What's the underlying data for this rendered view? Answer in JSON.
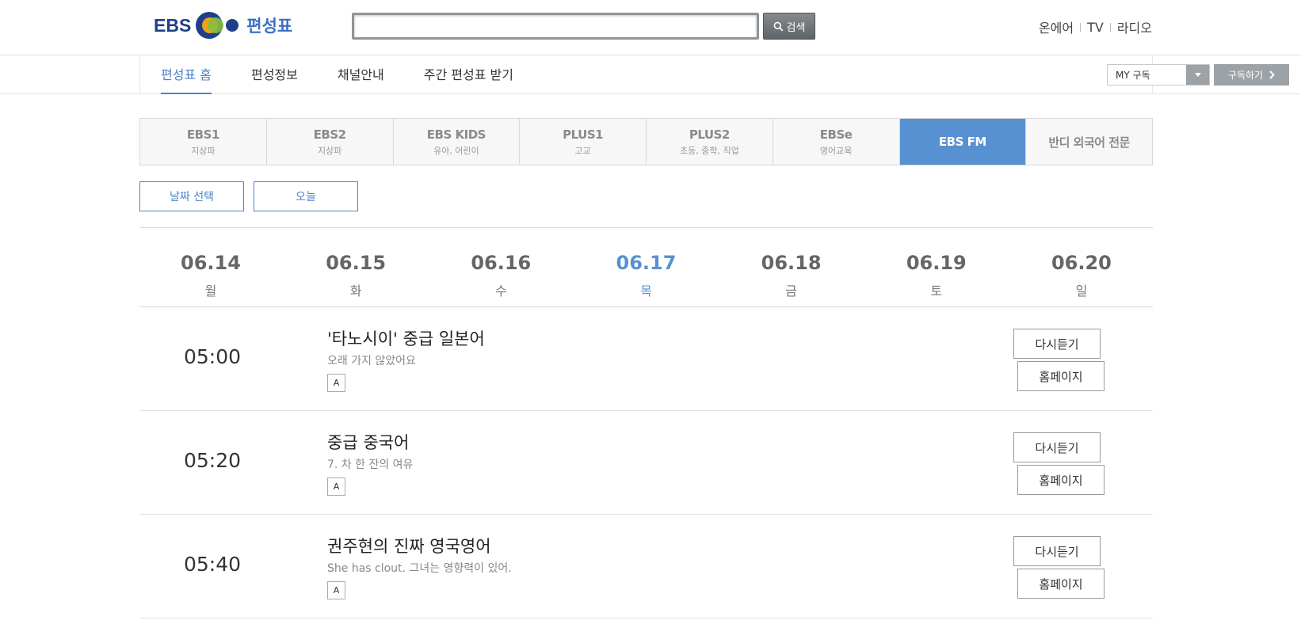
{
  "header": {
    "logo_text": "EBS",
    "logo_sub": "편성표",
    "search": {
      "value": "",
      "placeholder": "",
      "button_label": "검색"
    },
    "top_links": [
      "온에어",
      "TV",
      "라디오"
    ]
  },
  "nav": {
    "items": [
      "편성표 홈",
      "편성정보",
      "채널안내",
      "주간 편성표 받기"
    ],
    "active_index": 0,
    "my_select": "MY 구독",
    "subscribe_label": "구독하기"
  },
  "channels": [
    {
      "name": "EBS1",
      "desc": "지상파"
    },
    {
      "name": "EBS2",
      "desc": "지상파"
    },
    {
      "name": "EBS KIDS",
      "desc": "유아, 어린이"
    },
    {
      "name": "PLUS1",
      "desc": "고교"
    },
    {
      "name": "PLUS2",
      "desc": "초등, 중학, 직업"
    },
    {
      "name": "EBSe",
      "desc": "영어교육"
    },
    {
      "name": "EBS FM",
      "desc": ""
    },
    {
      "name": "반디 외국어 전문",
      "desc": ""
    }
  ],
  "active_channel": "EBS FM",
  "date_buttons": {
    "select": "날짜 선택",
    "today": "오늘"
  },
  "week": [
    {
      "date": "06.14",
      "weekday": "월"
    },
    {
      "date": "06.15",
      "weekday": "화"
    },
    {
      "date": "06.16",
      "weekday": "수"
    },
    {
      "date": "06.17",
      "weekday": "목"
    },
    {
      "date": "06.18",
      "weekday": "금"
    },
    {
      "date": "06.19",
      "weekday": "토"
    },
    {
      "date": "06.20",
      "weekday": "일"
    }
  ],
  "active_day": "06.17",
  "schedule": [
    {
      "time": "05:00",
      "title": "'타노시이' 중급 일본어",
      "subtitle": "오래 가지 않았어요",
      "grade": "A",
      "replay_label": "다시듣기",
      "home_label": "홈페이지"
    },
    {
      "time": "05:20",
      "title": "중급 중국어",
      "subtitle": "7. 차 한 잔의 여유",
      "grade": "A",
      "replay_label": "다시듣기",
      "home_label": "홈페이지"
    },
    {
      "time": "05:40",
      "title": "권주현의 진짜 영국영어",
      "subtitle": "She has clout. 그녀는 영향력이 있어.",
      "grade": "A",
      "replay_label": "다시듣기",
      "home_label": "홈페이지"
    }
  ],
  "colors": {
    "accent": "#5891d1",
    "brand": "#1e3f8c"
  },
  "icons": {
    "search": "search-icon",
    "dropdown": "chevron-down-icon",
    "subscribe": "chevron-right-icon"
  }
}
